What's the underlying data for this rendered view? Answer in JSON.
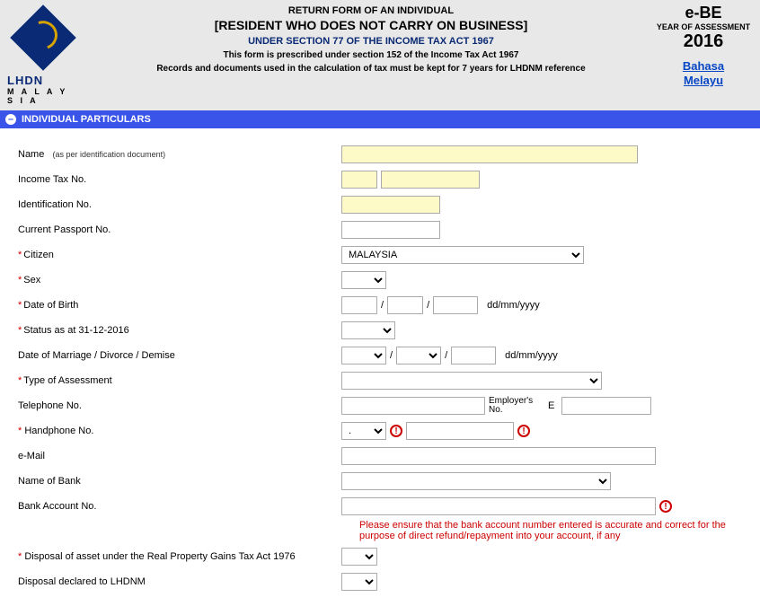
{
  "header": {
    "logo_main": "LHDN",
    "logo_sub": "M A L A Y S I A",
    "title1": "RETURN FORM OF AN INDIVIDUAL",
    "title2": "[RESIDENT WHO DOES NOT CARRY ON BUSINESS]",
    "title3": "UNDER SECTION 77 OF THE INCOME TAX ACT 1967",
    "title4": "This form is prescribed under section 152 of the Income Tax Act 1967",
    "title5": "Records and documents used in the calculation of tax must be kept for 7 years for LHDNM reference",
    "ebe": "e-BE",
    "yoa": "YEAR OF ASSESSMENT",
    "year": "2016",
    "lang1": "Bahasa",
    "lang2": "Melayu"
  },
  "section": {
    "title": "INDIVIDUAL PARTICULARS",
    "collapse": "–"
  },
  "labels": {
    "name": "Name",
    "name_sub": "(as per identification document)",
    "income_tax": "Income Tax No.",
    "id_no": "Identification No.",
    "passport": "Current Passport No.",
    "citizen": "Citizen",
    "sex": "Sex",
    "dob": "Date of Birth",
    "status": "Status as at 31-12-2016",
    "marriage": "Date of Marriage / Divorce / Demise",
    "type_assessment": "Type of Assessment",
    "telephone": "Telephone No.",
    "employer_no_line1": "Employer's",
    "employer_no_line2": "No.",
    "employer_e": "E",
    "handphone": " Handphone No.",
    "email": "e-Mail",
    "bank_name": "Name of Bank",
    "bank_acc": "Bank Account No.",
    "bank_note": "Please ensure that the bank account number entered is accurate and correct for the purpose of direct refund/repayment into your account, if any",
    "disposal_asset": " Disposal of asset under the Real Property Gains Tax Act 1976",
    "disposal_declared": "Disposal declared to LHDNM",
    "date_hint": "dd/mm/yyyy",
    "slash": "/",
    "hp_prefix": ". ",
    "warn": "!"
  },
  "values": {
    "citizen": "MALAYSIA"
  }
}
